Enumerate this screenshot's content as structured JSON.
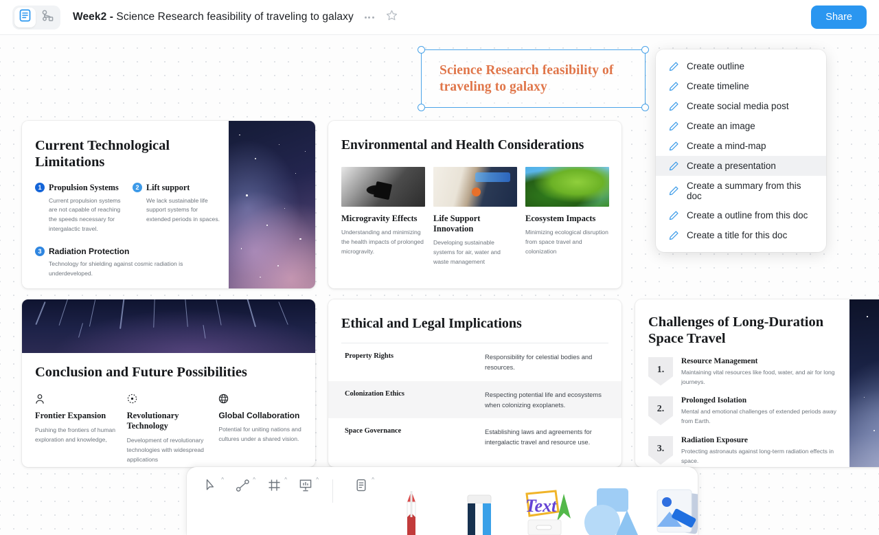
{
  "header": {
    "mode_doc_icon": "document-icon",
    "mode_flow_icon": "flowchart-icon",
    "breadcrumb_prefix": "Week2 - ",
    "doc_title": "Science Research feasibility of traveling to galaxy",
    "more_icon": "more-options-icon",
    "star_icon": "star-outline-icon",
    "share_label": "Share",
    "accent_blue": "#2a96f0"
  },
  "title_block": {
    "text": "Science Research feasibility of traveling to galaxy",
    "text_color": "#e0764a",
    "selection_color": "#4aa3e8",
    "selected": true
  },
  "ai_menu": {
    "icon": "pencil-icon",
    "highlighted": "Create a presentation",
    "items": [
      {
        "label": "Create outline"
      },
      {
        "label": "Create timeline"
      },
      {
        "label": "Create social media post"
      },
      {
        "label": "Create an image"
      },
      {
        "label": "Create a mind-map"
      },
      {
        "label": "Create a presentation"
      },
      {
        "label": "Create a summary from this doc"
      },
      {
        "label": "Create a outline from this doc"
      },
      {
        "label": "Create a title for this doc"
      }
    ]
  },
  "cards": {
    "tech": {
      "title": "Current Technological Limitations",
      "items": [
        {
          "num": "1",
          "title": "Propulsion Systems",
          "body": "Current propulsion systems are not capable of reaching the speeds necessary for intergalactic travel."
        },
        {
          "num": "2",
          "title": "Lift support",
          "body": "We lack sustainable life support systems for extended periods in spaces."
        },
        {
          "num": "3",
          "title": "Radiation Protection",
          "body": "Technology for shielding against cosmic radiation is underdeveloped."
        }
      ],
      "image": "galaxy-photo"
    },
    "env": {
      "title": "Environmental and Health Considerations",
      "items": [
        {
          "image": "microgravity-cube-photo",
          "title": "Microgravity Effects",
          "body": "Understanding and minimizing the health impacts of prolonged microgravity."
        },
        {
          "image": "life-support-hand-photo",
          "title": "Life Support Innovation",
          "body": "Developing sustainable systems for air, water and waste management"
        },
        {
          "image": "green-leaves-photo",
          "title": "Ecosystem Impacts",
          "body": "Minimizing ecological disruption from space travel and colonization"
        }
      ]
    },
    "conclusion": {
      "banner_image": "star-trails-photo",
      "title": "Conclusion and Future Possibilities",
      "items": [
        {
          "icon": "person-icon",
          "title": "Frontier Expansion",
          "body": "Pushing the frontiers of human exploration and knowledge,"
        },
        {
          "icon": "atom-icon",
          "title": "Revolutionary Technology",
          "body": "Development of revolutionary technologies with widespread applications"
        },
        {
          "icon": "globe-icon",
          "title": "Global Collaboration",
          "body": "Potential for uniting nations and cultures under a shared vision."
        }
      ]
    },
    "ethical": {
      "title": "Ethical and Legal Implications",
      "rows": [
        {
          "key": "Property Rights",
          "value": "Responsibility for celestial bodies and resources."
        },
        {
          "key": "Colonization Ethics",
          "value": "Respecting potential life and ecosystems when colonizing exoplanets."
        },
        {
          "key": "Space Governance",
          "value": "Establishing laws and agreements for intergalactic travel and resource use."
        }
      ],
      "highlighted_row_index": 1
    },
    "challenges": {
      "title": "Challenges of Long-Duration Space Travel",
      "items": [
        {
          "num": "1.",
          "title": "Resource Management",
          "body": "Maintaining vital resources like food, water, and air for long journeys."
        },
        {
          "num": "2.",
          "title": "Prolonged Isolation",
          "body": "Mental and emotional challenges of extended periods away from Earth."
        },
        {
          "num": "3.",
          "title": "Radiation Exposure",
          "body": "Protecting astronauts against long-term radiation effects in space."
        }
      ],
      "image": "galaxy-photo"
    }
  },
  "toolbar": {
    "tools": [
      {
        "icon": "cursor-select-icon"
      },
      {
        "icon": "connector-line-icon"
      },
      {
        "icon": "frame-icon"
      },
      {
        "icon": "presentation-board-icon"
      },
      {
        "icon": "document-icon"
      }
    ],
    "creators": [
      {
        "icon": "pencil-draw-icon"
      },
      {
        "icon": "eraser-icon"
      },
      {
        "icon": "text-icon"
      },
      {
        "icon": "shapes-icon"
      },
      {
        "icon": "image-upload-icon"
      },
      {
        "icon": "templates-icon"
      }
    ]
  }
}
